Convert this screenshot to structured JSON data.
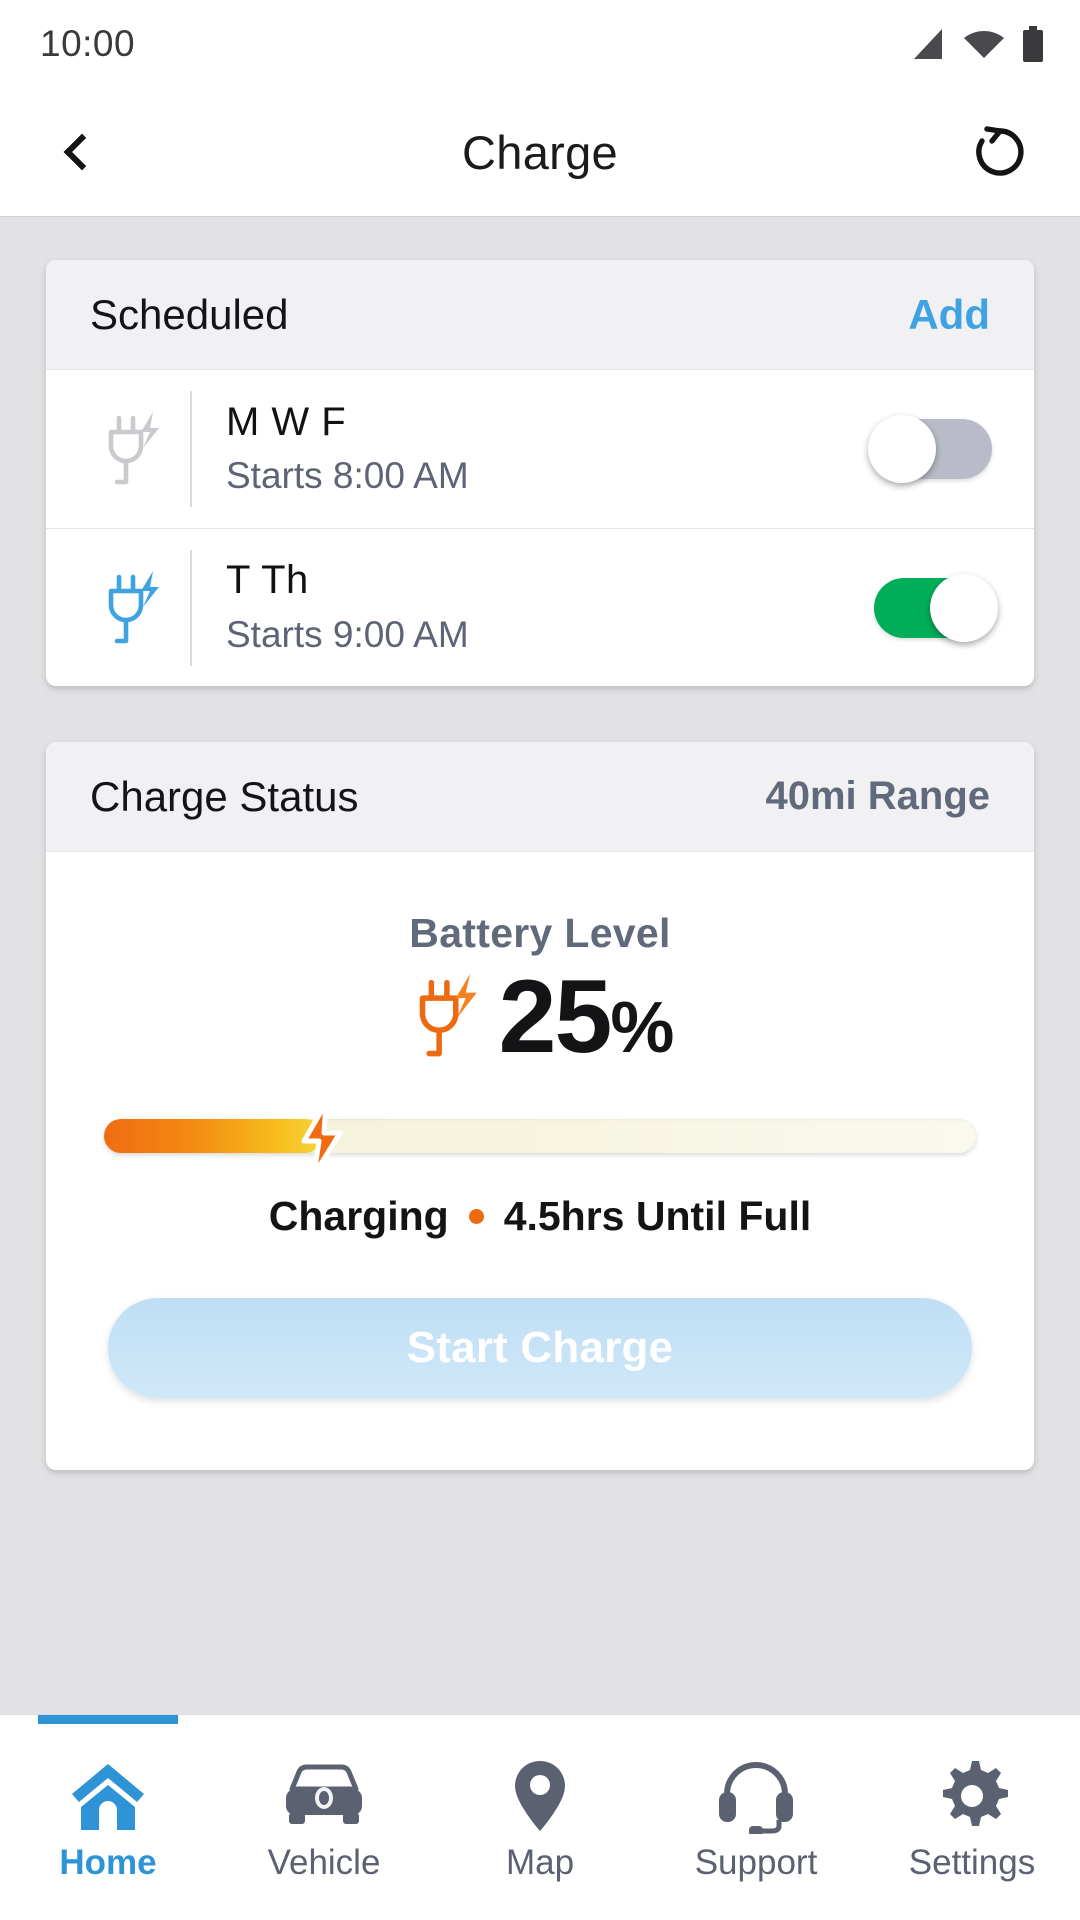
{
  "status_bar": {
    "time": "10:00",
    "icons": [
      "signal-icon",
      "wifi-icon",
      "battery-icon"
    ]
  },
  "header": {
    "back_icon": "chevron-left-icon",
    "title": "Charge",
    "refresh_icon": "history-refresh-icon"
  },
  "scheduled_card": {
    "title": "Scheduled",
    "add_label": "Add",
    "rows": [
      {
        "icon": "plug-bolt-icon",
        "icon_state": "inactive",
        "days": "M W F",
        "starts": "Starts 8:00 AM",
        "toggle": "off"
      },
      {
        "icon": "plug-bolt-icon",
        "icon_state": "active",
        "days": "T Th",
        "starts": "Starts 9:00 AM",
        "toggle": "on"
      }
    ]
  },
  "charge_status_card": {
    "title": "Charge Status",
    "range": "40mi Range",
    "battery_label": "Battery Level",
    "battery_icon": "plug-bolt-icon",
    "battery_value": "25",
    "battery_symbol": "%",
    "battery_percent": 25,
    "bar_marker_icon": "lightning-bolt-icon",
    "status_text": "Charging",
    "time_remaining": "4.5hrs Until Full",
    "start_button_label": "Start Charge"
  },
  "bottom_nav": {
    "items": [
      {
        "label": "Home",
        "icon": "home-icon",
        "active": true
      },
      {
        "label": "Vehicle",
        "icon": "car-icon",
        "active": false
      },
      {
        "label": "Map",
        "icon": "map-pin-icon",
        "active": false
      },
      {
        "label": "Support",
        "icon": "headset-icon",
        "active": false
      },
      {
        "label": "Settings",
        "icon": "gear-icon",
        "active": false
      }
    ]
  },
  "colors": {
    "accent_blue": "#2f94d6",
    "link_blue": "#3fa2e3",
    "toggle_on_green": "#00ae5a",
    "toggle_off_gray": "#b9bcc8",
    "charge_orange": "#ec6b12",
    "body_background": "#e2e2e4",
    "card_header": "#f1f1f4",
    "muted_text": "#5e6475"
  }
}
